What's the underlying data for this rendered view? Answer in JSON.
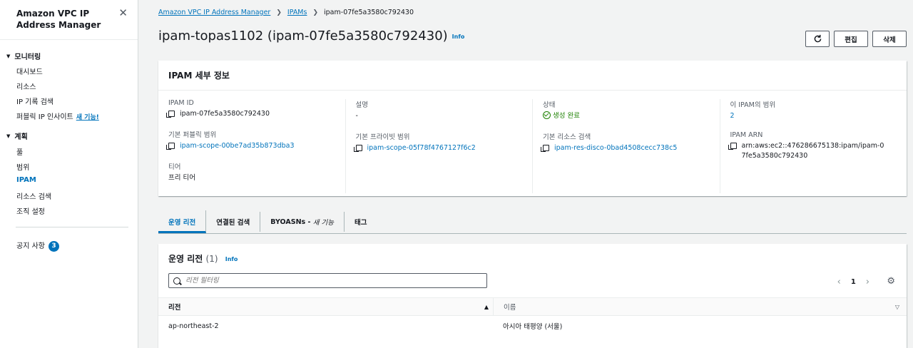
{
  "sidebar": {
    "title": "Amazon VPC IP Address Manager",
    "sections": [
      {
        "label": "모니터링",
        "items": [
          {
            "label": "대시보드"
          },
          {
            "label": "리소스"
          },
          {
            "label": "IP 기록 검색"
          },
          {
            "label": "퍼블릭 IP 인사이트",
            "new_badge": "새 기능!"
          }
        ]
      },
      {
        "label": "계획",
        "items": [
          {
            "label": "풀"
          },
          {
            "label": "범위"
          },
          {
            "label": "IPAM"
          },
          {
            "label": "리소스 검색"
          },
          {
            "label": "조직 설정"
          }
        ]
      }
    ],
    "notices": {
      "label": "공지 사항",
      "count": "3"
    }
  },
  "breadcrumb": {
    "root": "Amazon VPC IP Address Manager",
    "parent": "IPAMs",
    "current": "ipam-07fe5a3580c792430"
  },
  "page": {
    "title": "ipam-topas1102 (ipam-07fe5a3580c792430)",
    "info": "Info",
    "edit_label": "편집",
    "delete_label": "삭제"
  },
  "details": {
    "heading": "IPAM 세부 정보",
    "ipam_id_label": "IPAM ID",
    "ipam_id": "ipam-07fe5a3580c792430",
    "public_scope_label": "기본 퍼블릭 범위",
    "public_scope": "ipam-scope-00be7ad35b873dba3",
    "tier_label": "티어",
    "tier": "프리 티어",
    "description_label": "설명",
    "description": "-",
    "private_scope_label": "기본 프라이빗 범위",
    "private_scope": "ipam-scope-05f78f4767127f6c2",
    "status_label": "상태",
    "status": "생성 완료",
    "discovery_label": "기본 리소스 검색",
    "discovery": "ipam-res-disco-0bad4508cecc738c5",
    "scopes_label": "이 IPAM의 범위",
    "scopes": "2",
    "arn_label": "IPAM ARN",
    "arn": "arn:aws:ec2::476286675138:ipam/ipam-07fe5a3580c792430"
  },
  "tabs": [
    {
      "label": "운영 리전"
    },
    {
      "label": "연결된 검색"
    },
    {
      "label": "BYOASNs - ",
      "suffix": "새 기능"
    },
    {
      "label": "태그"
    }
  ],
  "regions": {
    "heading": "운영 리전",
    "count": "(1)",
    "info": "Info",
    "filter_placeholder": "리전 필터링",
    "page": "1",
    "columns": [
      "리전",
      "이름"
    ],
    "rows": [
      {
        "region": "ap-northeast-2",
        "name": "아시아 태평양 (서울)"
      }
    ]
  }
}
